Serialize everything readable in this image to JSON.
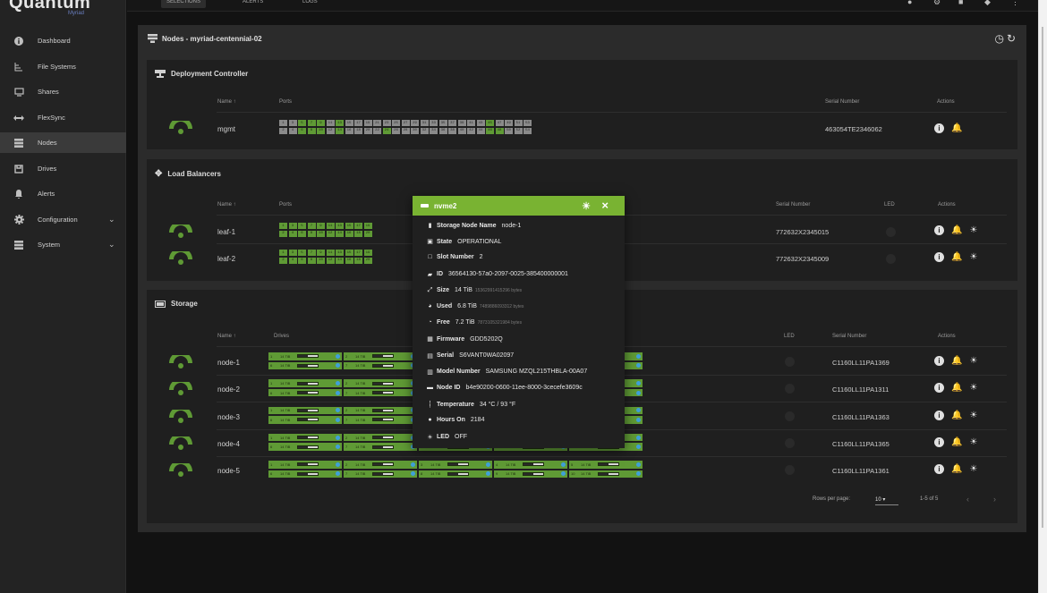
{
  "brand": {
    "name": "Quantum",
    "sub": "Myriad"
  },
  "topbar": {
    "tabs": [
      "SELECTIONS",
      "ALERTS",
      "LOGS"
    ]
  },
  "sidebar": {
    "items": [
      {
        "label": "Dashboard",
        "icon": "info-icon"
      },
      {
        "label": "File Systems",
        "icon": "tree-icon"
      },
      {
        "label": "Shares",
        "icon": "monitor-icon"
      },
      {
        "label": "FlexSync",
        "icon": "sync-arrows-icon"
      },
      {
        "label": "Nodes",
        "icon": "server-icon",
        "active": true
      },
      {
        "label": "Drives",
        "icon": "drive-icon"
      },
      {
        "label": "Alerts",
        "icon": "bell-icon"
      },
      {
        "label": "Configuration",
        "icon": "gear-icon",
        "expandable": true
      },
      {
        "label": "System",
        "icon": "server-icon",
        "expandable": true
      }
    ]
  },
  "page": {
    "title": "Nodes - myriad-centennial-02"
  },
  "deployment": {
    "title": "Deployment Controller",
    "headers": {
      "name": "Name",
      "ports": "Ports",
      "serial": "Serial Number",
      "actions": "Actions"
    },
    "rows": [
      {
        "name": "mgmt",
        "serial": "463054TE2346062"
      }
    ],
    "ports_top": [
      "1",
      "3",
      "5",
      "7",
      "9",
      "11",
      "13",
      "15",
      "17",
      "19",
      "21",
      "23",
      "25",
      "27",
      "29",
      "31",
      "33",
      "35",
      "37",
      "39",
      "41",
      "43",
      "45",
      "47",
      "49",
      "51",
      "53"
    ],
    "ports_bottom": [
      "2",
      "4",
      "6",
      "8",
      "10",
      "12",
      "14",
      "16",
      "18",
      "20",
      "22",
      "24",
      "26",
      "28",
      "30",
      "32",
      "34",
      "36",
      "38",
      "40",
      "42",
      "44",
      "46",
      "48",
      "50",
      "52",
      "54"
    ],
    "ports_top_on": [
      2,
      3,
      4,
      6,
      22
    ],
    "ports_bottom_on": [
      2,
      3,
      4,
      6,
      11,
      22,
      23
    ]
  },
  "load_balancers": {
    "title": "Load Balancers",
    "headers": {
      "name": "Name",
      "ports": "Ports",
      "serial": "Serial Number",
      "led": "LED",
      "actions": "Actions"
    },
    "rows": [
      {
        "name": "leaf-1",
        "serial": "772632X2345015"
      },
      {
        "name": "leaf-2",
        "serial": "772632X2345009"
      }
    ],
    "ports_top": [
      "1",
      "3",
      "5",
      "7",
      "9",
      "11",
      "13",
      "15",
      "17",
      "19"
    ],
    "ports_bottom": [
      "2",
      "4",
      "6",
      "8",
      "10",
      "12",
      "14",
      "16",
      "18",
      "20"
    ]
  },
  "storage": {
    "title": "Storage",
    "headers": {
      "name": "Name",
      "drives": "Drives",
      "led": "LED",
      "serial": "Serial Number",
      "actions": "Actions"
    },
    "rows": [
      {
        "name": "node-1",
        "serial": "C1160LL11PA1369"
      },
      {
        "name": "node-2",
        "serial": "C1160LL11PA1311"
      },
      {
        "name": "node-3",
        "serial": "C1160LL11PA1363"
      },
      {
        "name": "node-4",
        "serial": "C1160LL11PA1365"
      },
      {
        "name": "node-5",
        "serial": "C1160LL11PA1361"
      }
    ],
    "drive_size": "14 TiB",
    "drive_fill": 0.5,
    "pager": {
      "rows_label": "Rows per page:",
      "rows_value": "10",
      "range": "1-5 of 5"
    }
  },
  "popup": {
    "title": "nvme2",
    "fields": [
      {
        "icon": "storage-icon",
        "key": "Storage Node Name",
        "value": "node-1"
      },
      {
        "icon": "state-icon",
        "key": "State",
        "value": "OPERATIONAL"
      },
      {
        "icon": "slot-icon",
        "key": "Slot Number",
        "value": "2"
      },
      {
        "icon": "tag-icon",
        "key": "ID",
        "value": "36564130-57a0-2097-0025-385400000001"
      },
      {
        "icon": "expand-icon",
        "key": "Size",
        "value": "14 TiB",
        "bytes": "15362991415296 bytes"
      },
      {
        "icon": "pie-icon",
        "key": "Used",
        "value": "6.8 TiB",
        "bytes": "7489886093312 bytes"
      },
      {
        "icon": "pie-free-icon",
        "key": "Free",
        "value": "7.2 TiB",
        "bytes": "7873105321984 bytes"
      },
      {
        "icon": "firmware-icon",
        "key": "Firmware",
        "value": "GDD5202Q"
      },
      {
        "icon": "serial-icon",
        "key": "Serial",
        "value": "S6VANT0WA02097"
      },
      {
        "icon": "model-icon",
        "key": "Model Number",
        "value": "SAMSUNG MZQL215THBLA-00A07"
      },
      {
        "icon": "node-id-icon",
        "key": "Node ID",
        "value": "b4e90200-0600-11ee-8000-3cecefe3609c"
      },
      {
        "icon": "thermometer-icon",
        "key": "Temperature",
        "value": "34 °C / 93 °F"
      },
      {
        "icon": "clock-icon",
        "key": "Hours On",
        "value": "2184"
      },
      {
        "icon": "led-icon",
        "key": "LED",
        "value": "OFF"
      }
    ]
  },
  "colors": {
    "accent": "#79b332",
    "port_on": "#5f9a35",
    "port_off": "#8a8a8a",
    "drive_led": "#3fa0d8"
  }
}
